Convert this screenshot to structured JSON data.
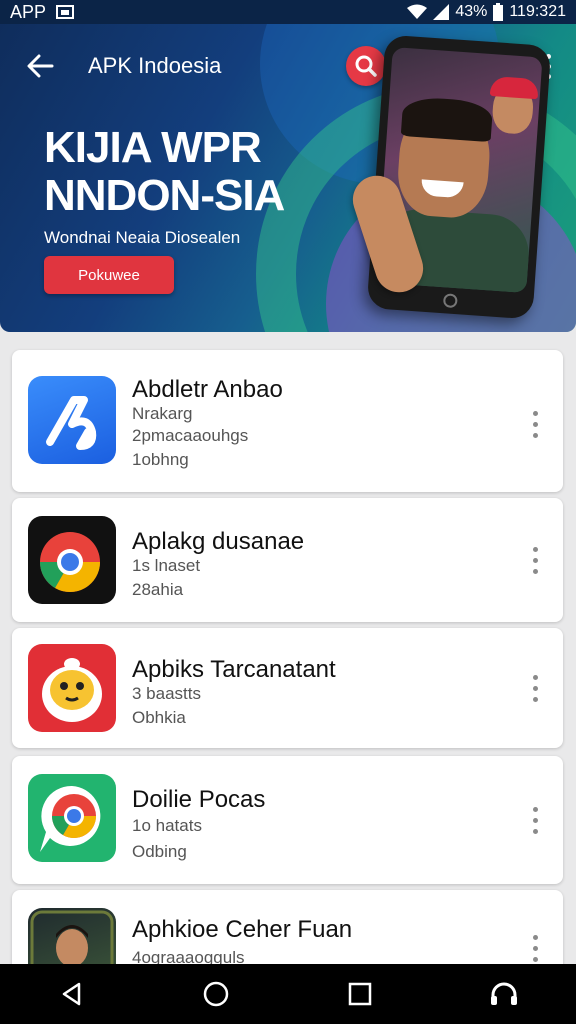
{
  "status_bar": {
    "app_label": "APP",
    "battery_pct": "43%",
    "time": "119:321"
  },
  "header": {
    "title": "APK Indoesia"
  },
  "hero": {
    "headline_line1": "KIJIA WPR",
    "headline_line2": "NNDON-SIA",
    "subtitle": "Wondnai Neaia Diosealen",
    "cta_label": "Pokuwee"
  },
  "apps": [
    {
      "name": "Abdletr Anbao",
      "meta": [
        "Nrakarg",
        "2pmacaaouhgs",
        "1obhng"
      ],
      "icon": "music-note-icon"
    },
    {
      "name": "Aplakg dusanae",
      "meta": [
        "1s lnaset",
        "28ahia"
      ],
      "icon": "chrome-icon"
    },
    {
      "name": "Apbiks Tarcanatant",
      "meta": [
        "3 baastts",
        "Obhkia"
      ],
      "icon": "chick-mascot-icon"
    },
    {
      "name": "Doilie Pocas",
      "meta": [
        "1o hatats",
        "Odbing"
      ],
      "icon": "chrome-bubble-icon"
    },
    {
      "name": "Aphkioe Ceher Fuan",
      "meta": [
        "4ograaaogguls"
      ],
      "icon": "person-photo-icon"
    }
  ],
  "colors": {
    "accent_red": "#e0353f",
    "hero_start": "#0f2d5c",
    "hero_end": "#1ba07a"
  }
}
